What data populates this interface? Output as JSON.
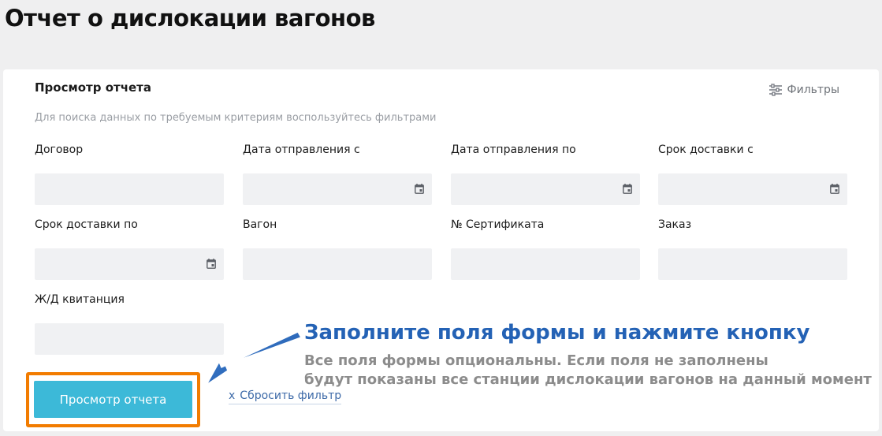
{
  "page": {
    "title": "Отчет о дислокации вагонов"
  },
  "panel": {
    "title": "Просмотр отчета",
    "filters_label": "Фильтры",
    "hint": "Для поиска данных по требуемым критериям воспользуйтесь фильтрами"
  },
  "fields": [
    {
      "label": "Договор",
      "value": "",
      "icon": null
    },
    {
      "label": "Дата отправления с",
      "value": "",
      "icon": "calendar-icon"
    },
    {
      "label": "Дата отправления по",
      "value": "",
      "icon": "calendar-icon"
    },
    {
      "label": "Срок доставки с",
      "value": "",
      "icon": "calendar-icon"
    },
    {
      "label": "Срок доставки по",
      "value": "",
      "icon": "calendar-icon"
    },
    {
      "label": "Вагон",
      "value": "",
      "icon": null
    },
    {
      "label": "№ Сертификата",
      "value": "",
      "icon": null
    },
    {
      "label": "Заказ",
      "value": "",
      "icon": null
    },
    {
      "label": "Ж/Д квитанция",
      "value": "",
      "icon": null
    }
  ],
  "actions": {
    "submit_label": "Просмотр отчета",
    "reset_mark": "x",
    "reset_label": "Сбросить фильтр"
  },
  "annotation": {
    "title": "Заполните поля формы и нажмите кнопку",
    "note_line1": "Все поля формы опциональны. Если поля не заполнены",
    "note_line2": "будут показаны все станции дислокации вагонов на данный момент"
  },
  "colors": {
    "accent_button": "#3cb9d8",
    "highlight_frame": "#f27c00",
    "annotation_title": "#2462b5",
    "annotation_arrow": "#2462b5",
    "link": "#3d6aa8"
  }
}
